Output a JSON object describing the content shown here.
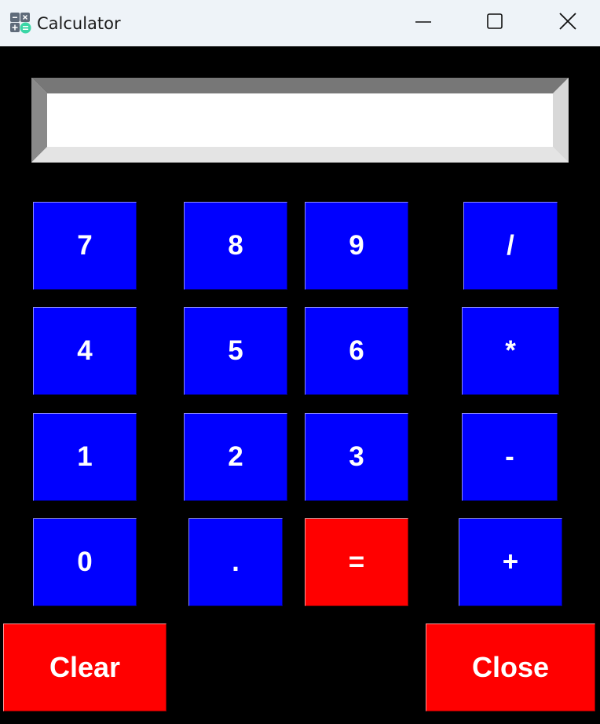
{
  "window": {
    "title": "Calculator",
    "icon": "calculator-app-icon",
    "controls": [
      "minimize-icon",
      "maximize-icon",
      "close-icon"
    ]
  },
  "display": {
    "value": "",
    "placeholder": ""
  },
  "keypad": {
    "row1": [
      "7",
      "8",
      "9",
      "/"
    ],
    "row2": [
      "4",
      "5",
      "6",
      "*"
    ],
    "row3": [
      "1",
      "2",
      "3",
      "-"
    ],
    "row4": [
      "0",
      ".",
      "=",
      "+"
    ]
  },
  "actions": {
    "clear_label": "Clear",
    "close_label": "Close"
  },
  "colors": {
    "key_blue": "#0000ff",
    "key_red": "#ff0000",
    "background": "#000000",
    "titlebar": "#eef3f8"
  }
}
